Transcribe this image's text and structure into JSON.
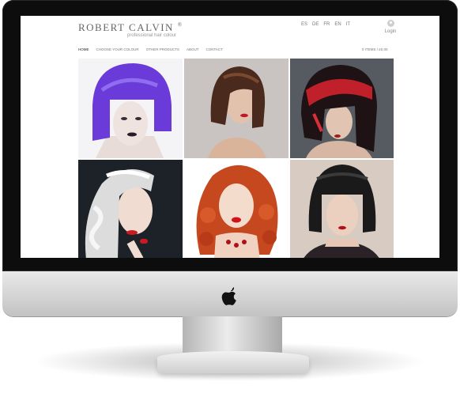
{
  "site": {
    "brand": "ROBERT CALVIN",
    "registered": "®",
    "tagline": "professional hair colour",
    "languages": [
      "ES",
      "DE",
      "FR",
      "EN",
      "IT"
    ],
    "login_label": "Login",
    "nav": [
      "HOME",
      "CHOOSE YOUR COLOUR",
      "OTHER PRODUCTS",
      "ABOUT",
      "CONTACT"
    ],
    "cart": "0 ITEMS / £0,00"
  },
  "gallery": [
    {
      "hair": "violet-blue bob",
      "color": "#6a3bd8"
    },
    {
      "hair": "dark brown bob",
      "color": "#4a2a1c"
    },
    {
      "hair": "red and black bob",
      "color": "#c0202a"
    },
    {
      "hair": "platinum waves",
      "color": "#dcdcdc"
    },
    {
      "hair": "copper curls",
      "color": "#c5481f"
    },
    {
      "hair": "black bob",
      "color": "#1a1a1a"
    }
  ],
  "hardware": {
    "logo_icon": "apple-icon"
  }
}
